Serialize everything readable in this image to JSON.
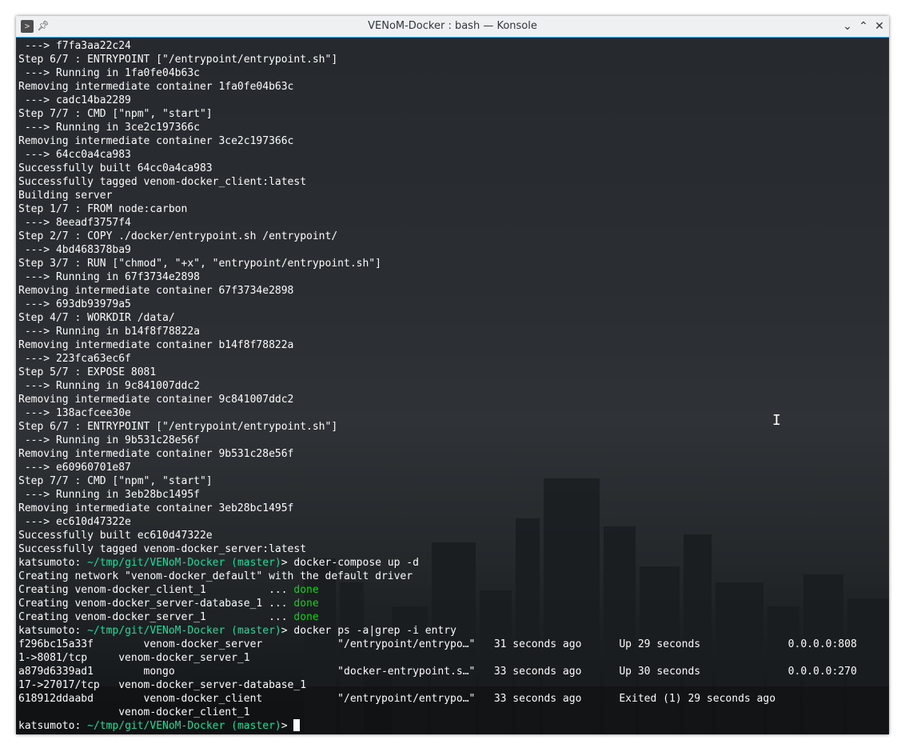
{
  "window": {
    "title": "VENoM-Docker : bash — Konsole",
    "app_icon": "konsole-icon",
    "controls": {
      "minimize": "chevron-down-icon",
      "maximize": "chevron-up-icon",
      "close": "close-icon"
    }
  },
  "terminal": {
    "lines": [
      " ---> f7fa3aa22c24",
      "Step 6/7 : ENTRYPOINT [\"/entrypoint/entrypoint.sh\"]",
      " ---> Running in 1fa0fe04b63c",
      "Removing intermediate container 1fa0fe04b63c",
      " ---> cadc14ba2289",
      "Step 7/7 : CMD [\"npm\", \"start\"]",
      " ---> Running in 3ce2c197366c",
      "Removing intermediate container 3ce2c197366c",
      " ---> 64cc0a4ca983",
      "Successfully built 64cc0a4ca983",
      "Successfully tagged venom-docker_client:latest",
      "Building server",
      "Step 1/7 : FROM node:carbon",
      " ---> 8eeadf3757f4",
      "Step 2/7 : COPY ./docker/entrypoint.sh /entrypoint/",
      " ---> 4bd468378ba9",
      "Step 3/7 : RUN [\"chmod\", \"+x\", \"entrypoint/entrypoint.sh\"]",
      " ---> Running in 67f3734e2898",
      "Removing intermediate container 67f3734e2898",
      " ---> 693db93979a5",
      "Step 4/7 : WORKDIR /data/",
      " ---> Running in b14f8f78822a",
      "Removing intermediate container b14f8f78822a",
      " ---> 223fca63ec6f",
      "Step 5/7 : EXPOSE 8081",
      " ---> Running in 9c841007ddc2",
      "Removing intermediate container 9c841007ddc2",
      " ---> 138acfcee30e",
      "Step 6/7 : ENTRYPOINT [\"/entrypoint/entrypoint.sh\"]",
      " ---> Running in 9b531c28e56f",
      "Removing intermediate container 9b531c28e56f",
      " ---> e60960701e87",
      "Step 7/7 : CMD [\"npm\", \"start\"]",
      " ---> Running in 3eb28bc1495f",
      "Removing intermediate container 3eb28bc1495f",
      " ---> ec610d47322e",
      "Successfully built ec610d47322e",
      "Successfully tagged venom-docker_server:latest"
    ],
    "prompt": {
      "user": "katsumoto:",
      "path": "~/tmp/git/VENoM-Docker",
      "branch": "(master)",
      "symbol": ">"
    },
    "cmd1": "docker-compose up -d",
    "compose_output": [
      {
        "text": "Creating network \"venom-docker_default\" with the default driver",
        "status": ""
      },
      {
        "text": "Creating venom-docker_client_1          ... ",
        "status": "done"
      },
      {
        "text": "Creating venom-docker_server-database_1 ... ",
        "status": "done"
      },
      {
        "text": "Creating venom-docker_server_1          ... ",
        "status": "done"
      }
    ],
    "cmd2": "docker ps -a|grep -i entry",
    "ps_output": [
      "f296bc15a33f        venom-docker_server            \"/entrypoint/entrypo…\"   31 seconds ago      Up 29 seconds              0.0.0.0:808",
      "1->8081/tcp     venom-docker_server_1",
      "a879d6339ad1        mongo                          \"docker-entrypoint.s…\"   33 seconds ago      Up 30 seconds              0.0.0.0:270",
      "17->27017/tcp   venom-docker_server-database_1",
      "618912ddaabd        venom-docker_client            \"/entrypoint/entrypo…\"   33 seconds ago      Exited (1) 29 seconds ago",
      "                venom-docker_client_1"
    ]
  }
}
